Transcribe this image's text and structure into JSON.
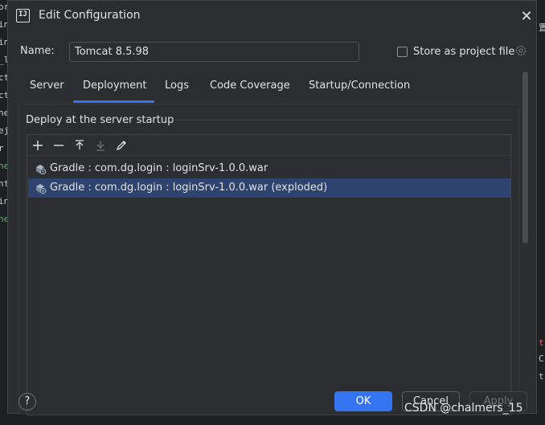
{
  "dialog": {
    "app_icon_text": "IJ",
    "title": "Edit Configuration"
  },
  "name_field": {
    "label": "Name:",
    "value": "Tomcat 8.5.98"
  },
  "store_option": {
    "label": "Store as project file",
    "checked": false
  },
  "tabs": [
    {
      "label": "Server"
    },
    {
      "label": "Deployment",
      "active": true
    },
    {
      "label": "Logs"
    },
    {
      "label": "Code Coverage"
    },
    {
      "label": "Startup/Connection"
    }
  ],
  "deploy_section": {
    "title": "Deploy at the server startup",
    "toolbar": [
      "add-icon",
      "remove-icon",
      "move-up-icon",
      "move-down-icon",
      "edit-icon"
    ],
    "items": [
      {
        "label": "Gradle : com.dg.login : loginSrv-1.0.0.war",
        "selected": false
      },
      {
        "label": "Gradle : com.dg.login : loginSrv-1.0.0.war (exploded)",
        "selected": true
      }
    ]
  },
  "footer": {
    "help_label": "?",
    "ok_label": "OK",
    "cancel_label": "Cancel",
    "apply_label": "Apply"
  },
  "watermark": "CSDN @chalmers_15",
  "colors": {
    "accent": "#3574f0",
    "dialog_bg": "#2b2d30",
    "selection": "#2e436e",
    "text": "#dfe1e5"
  }
}
